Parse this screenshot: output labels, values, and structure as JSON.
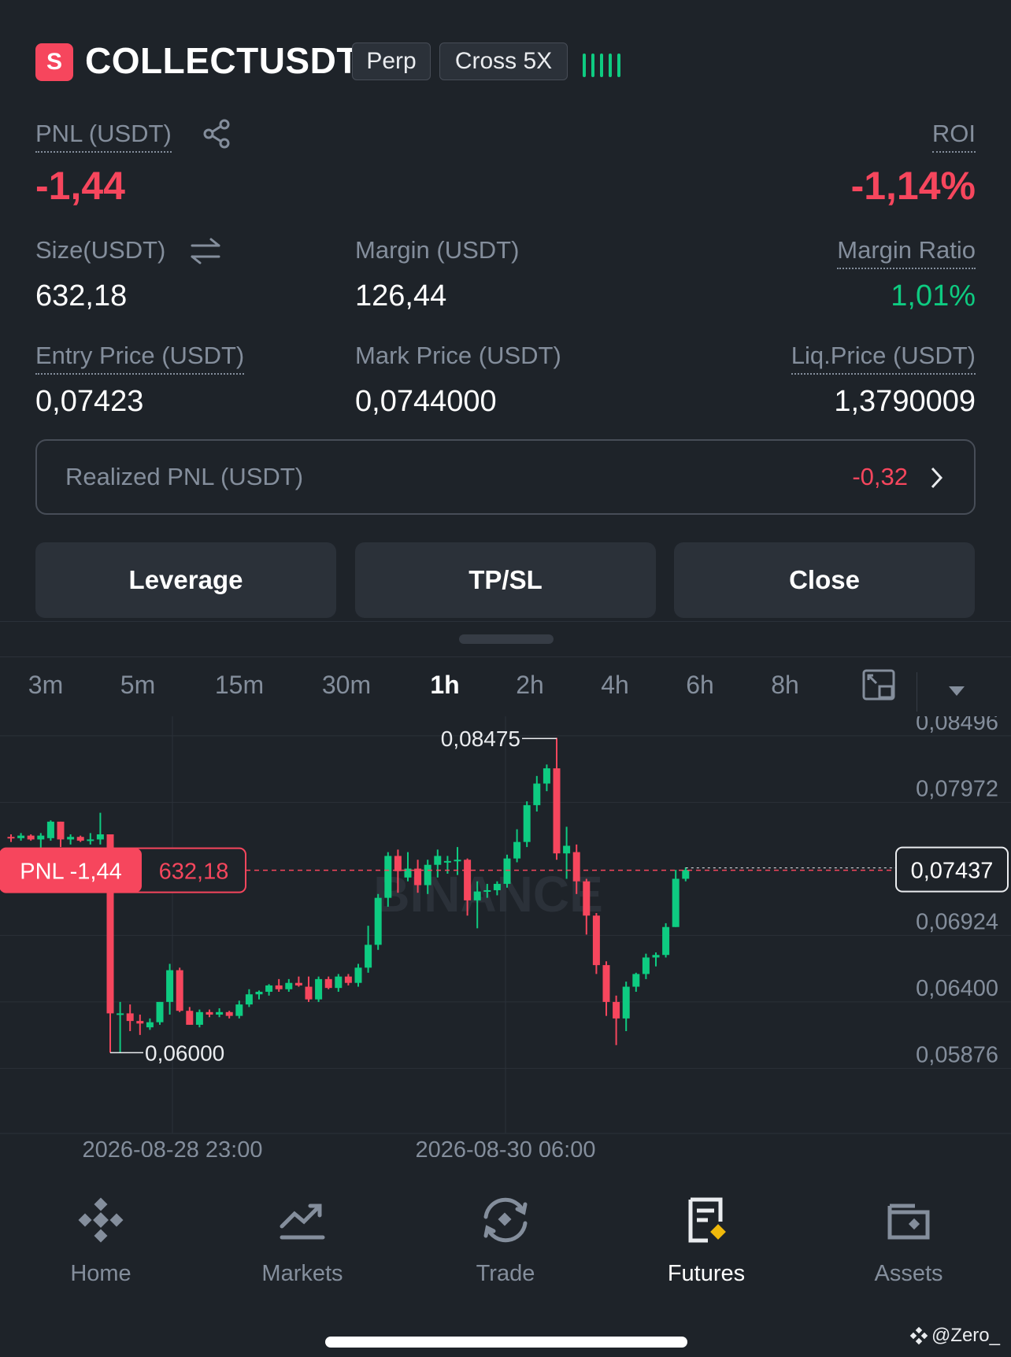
{
  "header": {
    "symbol_badge": "S",
    "symbol": "COLLECTUSDT",
    "tags": [
      "Perp",
      "Cross 5X"
    ],
    "signal_icon": "bar-signal-icon"
  },
  "stats": {
    "pnl_label": "PNL (USDT)",
    "pnl_value": "-1,44",
    "roi_label": "ROI",
    "roi_value": "-1,14%",
    "size_label": "Size(USDT)",
    "size_value": "632,18",
    "margin_label": "Margin (USDT)",
    "margin_value": "126,44",
    "margin_ratio_label": "Margin Ratio",
    "margin_ratio_value": "1,01%",
    "entry_label": "Entry Price (USDT)",
    "entry_value": "0,07423",
    "mark_label": "Mark Price (USDT)",
    "mark_value": "0,0744000",
    "liq_label": "Liq.Price (USDT)",
    "liq_value": "1,3790009"
  },
  "realized": {
    "label": "Realized PNL (USDT)",
    "value": "-0,32"
  },
  "actions": {
    "leverage": "Leverage",
    "tpsl": "TP/SL",
    "close": "Close"
  },
  "timeframes": [
    "3m",
    "5m",
    "15m",
    "30m",
    "1h",
    "2h",
    "4h",
    "6h",
    "8h"
  ],
  "active_timeframe": "1h",
  "chart": {
    "y_ticks": [
      "0,08496",
      "0,07972",
      "0,07437",
      "0,06924",
      "0,06400",
      "0,05876"
    ],
    "high_label": "0,08475",
    "low_label": "0,06000",
    "current_price": "0,07437",
    "pnl_tag": "PNL -1,44",
    "size_tag": "632,18",
    "x_ticks": [
      "2026-08-28 23:00",
      "2026-08-30 06:00"
    ],
    "watermark": "BINANCE"
  },
  "chart_data": {
    "type": "candlestick",
    "interval": "1h",
    "ylim": [
      0.0555,
      0.0865
    ],
    "y_ticks": [
      0.08496,
      0.07972,
      0.07437,
      0.06924,
      0.064,
      0.05876
    ],
    "current_price": 0.07437,
    "high": 0.08475,
    "low": 0.06,
    "candles": [
      {
        "o": 0.077,
        "h": 0.0772,
        "l": 0.0766,
        "c": 0.0769
      },
      {
        "o": 0.0769,
        "h": 0.0773,
        "l": 0.0767,
        "c": 0.0771
      },
      {
        "o": 0.0771,
        "h": 0.0772,
        "l": 0.0767,
        "c": 0.0768
      },
      {
        "o": 0.0768,
        "h": 0.0773,
        "l": 0.0759,
        "c": 0.0771
      },
      {
        "o": 0.0769,
        "h": 0.0783,
        "l": 0.0767,
        "c": 0.0782
      },
      {
        "o": 0.0782,
        "h": 0.0782,
        "l": 0.0762,
        "c": 0.0768
      },
      {
        "o": 0.0768,
        "h": 0.0772,
        "l": 0.0764,
        "c": 0.077
      },
      {
        "o": 0.077,
        "h": 0.0771,
        "l": 0.0766,
        "c": 0.0767
      },
      {
        "o": 0.0767,
        "h": 0.0773,
        "l": 0.0764,
        "c": 0.0768
      },
      {
        "o": 0.0768,
        "h": 0.0789,
        "l": 0.0764,
        "c": 0.0772
      },
      {
        "o": 0.0772,
        "h": 0.0772,
        "l": 0.06,
        "c": 0.0631
      },
      {
        "o": 0.0631,
        "h": 0.064,
        "l": 0.06,
        "c": 0.0631
      },
      {
        "o": 0.0631,
        "h": 0.0638,
        "l": 0.0617,
        "c": 0.0625
      },
      {
        "o": 0.0625,
        "h": 0.063,
        "l": 0.0614,
        "c": 0.0623
      },
      {
        "o": 0.062,
        "h": 0.0627,
        "l": 0.0618,
        "c": 0.0624
      },
      {
        "o": 0.0624,
        "h": 0.064,
        "l": 0.0622,
        "c": 0.064
      },
      {
        "o": 0.064,
        "h": 0.067,
        "l": 0.063,
        "c": 0.0665
      },
      {
        "o": 0.0665,
        "h": 0.0667,
        "l": 0.0632,
        "c": 0.0633
      },
      {
        "o": 0.0633,
        "h": 0.0636,
        "l": 0.0622,
        "c": 0.0622
      },
      {
        "o": 0.0622,
        "h": 0.0634,
        "l": 0.062,
        "c": 0.0632
      },
      {
        "o": 0.0632,
        "h": 0.0634,
        "l": 0.0628,
        "c": 0.063
      },
      {
        "o": 0.063,
        "h": 0.0635,
        "l": 0.0628,
        "c": 0.0632
      },
      {
        "o": 0.0632,
        "h": 0.0633,
        "l": 0.0627,
        "c": 0.0629
      },
      {
        "o": 0.0629,
        "h": 0.0641,
        "l": 0.0627,
        "c": 0.0638
      },
      {
        "o": 0.0638,
        "h": 0.065,
        "l": 0.0636,
        "c": 0.0646
      },
      {
        "o": 0.0646,
        "h": 0.0649,
        "l": 0.0642,
        "c": 0.0648
      },
      {
        "o": 0.0648,
        "h": 0.0654,
        "l": 0.0645,
        "c": 0.0653
      },
      {
        "o": 0.0653,
        "h": 0.0658,
        "l": 0.0648,
        "c": 0.065
      },
      {
        "o": 0.065,
        "h": 0.0658,
        "l": 0.0648,
        "c": 0.0655
      },
      {
        "o": 0.0655,
        "h": 0.066,
        "l": 0.0652,
        "c": 0.0653
      },
      {
        "o": 0.0652,
        "h": 0.066,
        "l": 0.064,
        "c": 0.0642
      },
      {
        "o": 0.0642,
        "h": 0.066,
        "l": 0.064,
        "c": 0.0658
      },
      {
        "o": 0.0658,
        "h": 0.066,
        "l": 0.065,
        "c": 0.0651
      },
      {
        "o": 0.0651,
        "h": 0.0662,
        "l": 0.0648,
        "c": 0.066
      },
      {
        "o": 0.066,
        "h": 0.0662,
        "l": 0.0653,
        "c": 0.0655
      },
      {
        "o": 0.0655,
        "h": 0.067,
        "l": 0.0652,
        "c": 0.0667
      },
      {
        "o": 0.0667,
        "h": 0.07,
        "l": 0.0663,
        "c": 0.0685
      },
      {
        "o": 0.0685,
        "h": 0.0725,
        "l": 0.0681,
        "c": 0.0722
      },
      {
        "o": 0.0722,
        "h": 0.0758,
        "l": 0.0715,
        "c": 0.0755
      },
      {
        "o": 0.0755,
        "h": 0.076,
        "l": 0.0726,
        "c": 0.0743
      },
      {
        "o": 0.0738,
        "h": 0.0758,
        "l": 0.0735,
        "c": 0.0745
      },
      {
        "o": 0.0745,
        "h": 0.0752,
        "l": 0.0726,
        "c": 0.0732
      },
      {
        "o": 0.0732,
        "h": 0.0752,
        "l": 0.0725,
        "c": 0.0748
      },
      {
        "o": 0.0748,
        "h": 0.076,
        "l": 0.0738,
        "c": 0.0755
      },
      {
        "o": 0.075,
        "h": 0.0755,
        "l": 0.0741,
        "c": 0.0751
      },
      {
        "o": 0.0751,
        "h": 0.0762,
        "l": 0.074,
        "c": 0.0752
      },
      {
        "o": 0.0752,
        "h": 0.0753,
        "l": 0.0708,
        "c": 0.072
      },
      {
        "o": 0.072,
        "h": 0.0735,
        "l": 0.0698,
        "c": 0.0727
      },
      {
        "o": 0.0727,
        "h": 0.0733,
        "l": 0.0722,
        "c": 0.0728
      },
      {
        "o": 0.0728,
        "h": 0.0735,
        "l": 0.0724,
        "c": 0.0733
      },
      {
        "o": 0.0733,
        "h": 0.0756,
        "l": 0.073,
        "c": 0.0753
      },
      {
        "o": 0.0753,
        "h": 0.0776,
        "l": 0.075,
        "c": 0.0766
      },
      {
        "o": 0.0766,
        "h": 0.0798,
        "l": 0.0762,
        "c": 0.0795
      },
      {
        "o": 0.0795,
        "h": 0.0818,
        "l": 0.079,
        "c": 0.0812
      },
      {
        "o": 0.0812,
        "h": 0.0827,
        "l": 0.0806,
        "c": 0.0824
      },
      {
        "o": 0.0824,
        "h": 0.0848,
        "l": 0.0752,
        "c": 0.0757
      },
      {
        "o": 0.0757,
        "h": 0.0778,
        "l": 0.0737,
        "c": 0.0763
      },
      {
        "o": 0.0758,
        "h": 0.0764,
        "l": 0.0725,
        "c": 0.0735
      },
      {
        "o": 0.0735,
        "h": 0.0737,
        "l": 0.0693,
        "c": 0.0708
      },
      {
        "o": 0.0708,
        "h": 0.071,
        "l": 0.0662,
        "c": 0.0669
      },
      {
        "o": 0.0669,
        "h": 0.0672,
        "l": 0.0629,
        "c": 0.064
      },
      {
        "o": 0.064,
        "h": 0.0645,
        "l": 0.0606,
        "c": 0.0627
      },
      {
        "o": 0.0627,
        "h": 0.0656,
        "l": 0.0617,
        "c": 0.0652
      },
      {
        "o": 0.0652,
        "h": 0.0663,
        "l": 0.0648,
        "c": 0.0662
      },
      {
        "o": 0.0662,
        "h": 0.0678,
        "l": 0.0658,
        "c": 0.0675
      },
      {
        "o": 0.0675,
        "h": 0.0679,
        "l": 0.0668,
        "c": 0.0677
      },
      {
        "o": 0.0677,
        "h": 0.0702,
        "l": 0.0675,
        "c": 0.0699
      },
      {
        "o": 0.0699,
        "h": 0.0744,
        "l": 0.0699,
        "c": 0.0737
      },
      {
        "o": 0.0737,
        "h": 0.0746,
        "l": 0.0735,
        "c": 0.0744
      }
    ]
  },
  "nav": [
    {
      "label": "Home",
      "icon": "home-icon"
    },
    {
      "label": "Markets",
      "icon": "markets-icon"
    },
    {
      "label": "Trade",
      "icon": "trade-icon"
    },
    {
      "label": "Futures",
      "icon": "futures-icon"
    },
    {
      "label": "Assets",
      "icon": "assets-icon"
    }
  ],
  "active_nav": "Futures",
  "watermark_text": "@Zero_",
  "colors": {
    "up": "#0ecb81",
    "down": "#f6465d",
    "bg": "#1e2329",
    "accent": "#f0b90b"
  }
}
